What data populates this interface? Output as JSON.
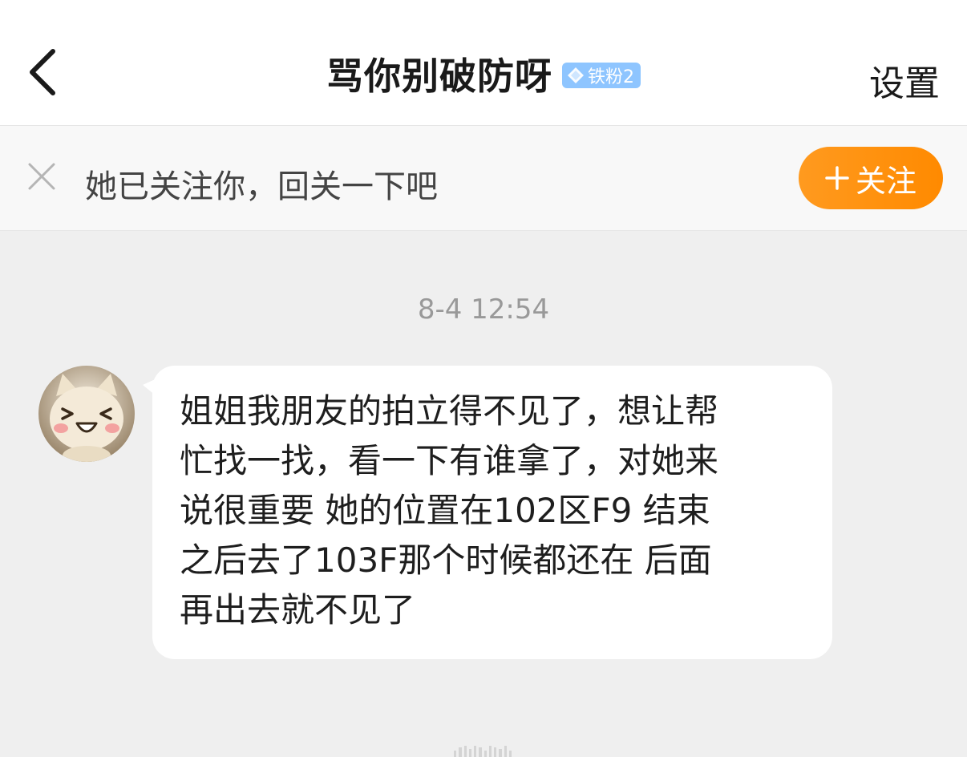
{
  "header": {
    "title": "骂你别破防呀",
    "badge_label": "铁粉2",
    "settings_label": "设置",
    "back_icon": "chevron-left-icon"
  },
  "follow_bar": {
    "text": "她已关注你，回关一下吧",
    "button_label": "关注",
    "button_color": "#ff9a1f"
  },
  "conversation": {
    "timestamp": "8-4 12:54",
    "messages": [
      {
        "lines": [
          "姐姐我朋友的拍立得不见了，想让帮",
          "忙找一找，看一下有谁拿了，对她来",
          "说很重要 她的位置在102区F9 结束",
          "之后去了103F那个时候都还在 后面",
          "再出去就不见了"
        ]
      }
    ]
  },
  "colors": {
    "background": "#efefef",
    "accent": "#ff9a1f",
    "badge": "#8ec5ff"
  }
}
